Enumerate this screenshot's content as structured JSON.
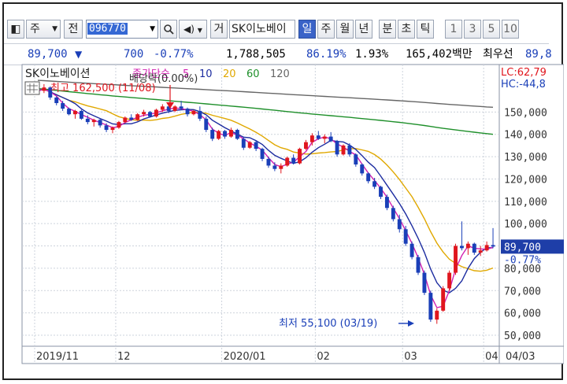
{
  "toolbar": {
    "market_label": "주",
    "prev_label": "전",
    "code": "096770",
    "name_label": "거",
    "name": "SK이노베이",
    "periods": [
      "일",
      "주",
      "월",
      "년",
      "분",
      "초",
      "틱"
    ],
    "selected_period": "일",
    "intervals": [
      "1",
      "3",
      "5",
      "10"
    ]
  },
  "quote": {
    "price": "89,700",
    "direction": "▼",
    "change": "700",
    "change_pct": "-0.77%",
    "volume": "1,788,505",
    "vol_ratio": "86.19%",
    "turnover": "1.93%",
    "amount": "165,402백만",
    "best_label": "최우선",
    "best_price": "89,8"
  },
  "colors": {
    "up": "#e0161e",
    "down": "#1a3fb8",
    "ma5": "#d11fb0",
    "ma10": "#1c2ca0",
    "ma20": "#e0a800",
    "ma60": "#1e8f2a",
    "ma120": "#666666",
    "price_box": "#1e3ea8"
  },
  "chart_data": {
    "type": "candlestick",
    "title": "SK이노베이션",
    "legend": {
      "prefix": "종가단순",
      "periods": [
        "5",
        "10",
        "20",
        "60",
        "120"
      ]
    },
    "ylim": [
      50000,
      162500
    ],
    "y_ticks": [
      150000,
      140000,
      130000,
      120000,
      110000,
      100000,
      90000,
      80000,
      70000,
      60000,
      50000
    ],
    "y_tick_labels": [
      "150,000",
      "140,000",
      "130,000",
      "120,000",
      "110,000",
      "100,000",
      "90,000",
      "80,000",
      "70,000",
      "60,000",
      "50,000"
    ],
    "x_labels": [
      "2019/11",
      "12",
      "2020/01",
      "02",
      "03",
      "04",
      "04/03"
    ],
    "current_price_label": "89,700",
    "current_change_label": "-0.77%",
    "lc_label": "LC:62,79",
    "hc_label": "HC:-44,8",
    "annotations": {
      "high": "최고 162,500 (11/08)",
      "dividend": "배당락(0.00%)",
      "low": "최저 55,100 (03/19)"
    },
    "candles": [
      [
        159500,
        161500,
        158000,
        159500
      ],
      [
        159500,
        162500,
        158500,
        161000
      ],
      [
        161000,
        161500,
        155500,
        156500
      ],
      [
        156500,
        157000,
        153000,
        154000
      ],
      [
        154000,
        155000,
        150500,
        151500
      ],
      [
        151500,
        152000,
        148500,
        149000
      ],
      [
        149000,
        151000,
        147000,
        150500
      ],
      [
        150500,
        151000,
        146500,
        147000
      ],
      [
        147000,
        148500,
        144500,
        145500
      ],
      [
        145500,
        147000,
        143500,
        146500
      ],
      [
        146500,
        147000,
        143000,
        144000
      ],
      [
        144000,
        145000,
        141000,
        142000
      ],
      [
        142000,
        143500,
        140500,
        143000
      ],
      [
        143000,
        146000,
        142500,
        145500
      ],
      [
        145500,
        148000,
        145000,
        147500
      ],
      [
        147500,
        149000,
        146000,
        146500
      ],
      [
        146500,
        149500,
        146000,
        149000
      ],
      [
        149000,
        151000,
        148000,
        150000
      ],
      [
        150000,
        150500,
        147500,
        148000
      ],
      [
        148000,
        151500,
        147500,
        151000
      ],
      [
        151000,
        153500,
        150000,
        152500
      ],
      [
        152500,
        153000,
        149500,
        150500
      ],
      [
        150500,
        153000,
        150000,
        152500
      ],
      [
        152500,
        155000,
        151000,
        151500
      ],
      [
        151500,
        152000,
        148000,
        149000
      ],
      [
        149000,
        151000,
        148500,
        150500
      ],
      [
        150500,
        152500,
        146000,
        147000
      ],
      [
        147000,
        148000,
        141000,
        142000
      ],
      [
        142000,
        143000,
        137000,
        138000
      ],
      [
        138000,
        142000,
        137500,
        141500
      ],
      [
        141500,
        142000,
        138000,
        139000
      ],
      [
        139000,
        143000,
        138500,
        142000
      ],
      [
        142000,
        142500,
        137500,
        138000
      ],
      [
        138000,
        139000,
        133000,
        134000
      ],
      [
        134000,
        137000,
        133500,
        136500
      ],
      [
        136500,
        137000,
        132500,
        133500
      ],
      [
        133500,
        134000,
        128000,
        129000
      ],
      [
        129000,
        130000,
        125000,
        126000
      ],
      [
        126000,
        127500,
        123500,
        124500
      ],
      [
        124500,
        127000,
        122500,
        126000
      ],
      [
        126000,
        130000,
        125500,
        129500
      ],
      [
        129500,
        131000,
        126500,
        127000
      ],
      [
        127000,
        134000,
        126500,
        133500
      ],
      [
        133500,
        137500,
        133000,
        136500
      ],
      [
        136500,
        140500,
        135000,
        139500
      ],
      [
        139500,
        141500,
        137500,
        138000
      ],
      [
        138000,
        140000,
        136000,
        139000
      ],
      [
        139000,
        141000,
        136500,
        137000
      ],
      [
        137000,
        137500,
        130000,
        131000
      ],
      [
        131000,
        135500,
        130500,
        135000
      ],
      [
        135000,
        136000,
        130000,
        131000
      ],
      [
        131000,
        131500,
        125500,
        126500
      ],
      [
        126500,
        127000,
        121500,
        122500
      ],
      [
        122500,
        123000,
        118000,
        119000
      ],
      [
        119000,
        120500,
        115500,
        116500
      ],
      [
        116500,
        117000,
        111000,
        112000
      ],
      [
        112000,
        113000,
        106000,
        107000
      ],
      [
        107000,
        108000,
        101000,
        102000
      ],
      [
        102000,
        104000,
        96000,
        97500
      ],
      [
        97500,
        99000,
        90000,
        91000
      ],
      [
        91000,
        92000,
        84000,
        85000
      ],
      [
        85000,
        86000,
        77000,
        78000
      ],
      [
        78000,
        79000,
        68000,
        69000
      ],
      [
        69000,
        70000,
        56000,
        57000
      ],
      [
        57000,
        62000,
        55100,
        61000
      ],
      [
        61000,
        72000,
        60500,
        71000
      ],
      [
        71000,
        79000,
        70000,
        78000
      ],
      [
        78000,
        91000,
        77000,
        90000
      ],
      [
        90000,
        101000,
        88000,
        89000
      ],
      [
        89000,
        92000,
        86000,
        91000
      ],
      [
        91000,
        91500,
        86000,
        87000
      ],
      [
        87000,
        90000,
        85500,
        88000
      ],
      [
        88000,
        92000,
        87500,
        90400
      ],
      [
        90400,
        98000,
        89000,
        89700
      ]
    ]
  }
}
